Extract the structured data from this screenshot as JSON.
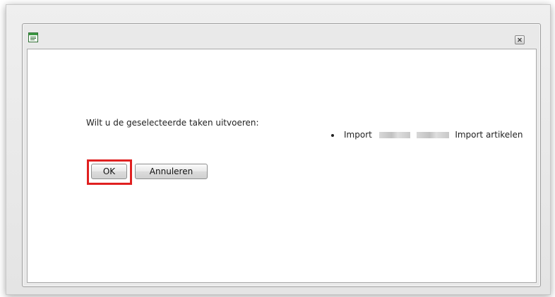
{
  "dialog": {
    "close_icon": "close-icon",
    "app_icon": "app-window-icon"
  },
  "content": {
    "prompt": "Wilt u de geselecteerde taken uitvoeren:",
    "tasks": [
      {
        "prefix": "Import",
        "suffix": "Import artikelen"
      }
    ]
  },
  "buttons": {
    "ok_label": "OK",
    "cancel_label": "Annuleren"
  },
  "colors": {
    "highlight": "#e02020",
    "icon_green": "#2f8f3a"
  }
}
